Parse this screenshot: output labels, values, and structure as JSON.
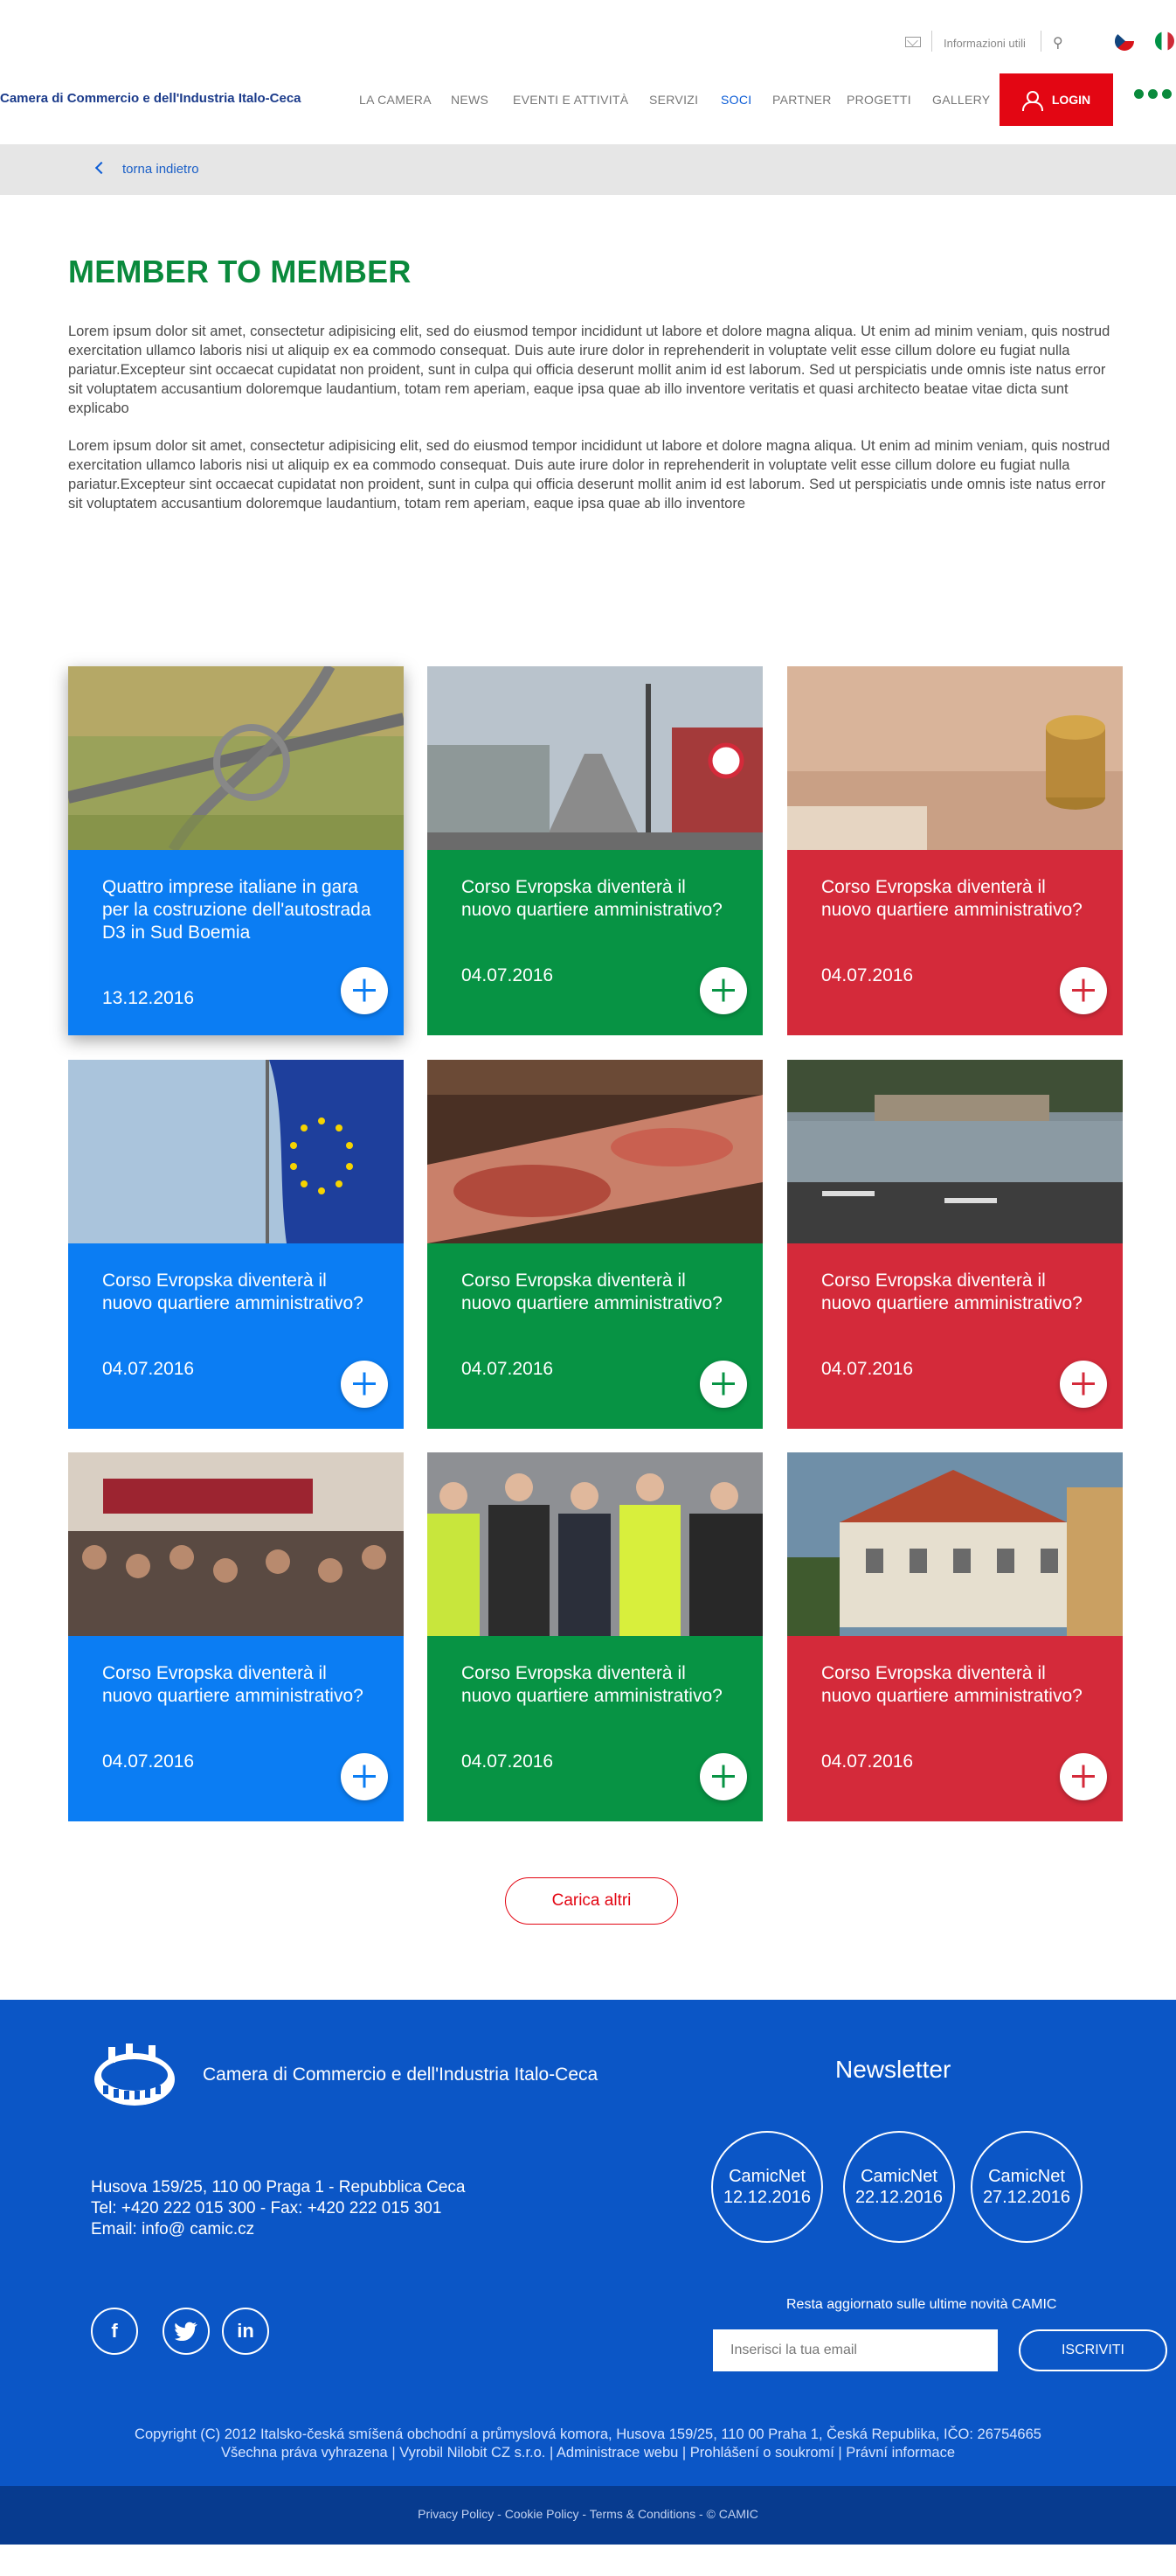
{
  "utility": {
    "info_label": "Informazioni utili"
  },
  "header": {
    "brand": "Camera di Commercio e dell'Industria Italo-Ceca",
    "nav": [
      "LA CAMERA",
      "NEWS",
      "EVENTI E ATTIVITÀ",
      "SERVIZI",
      "SOCI",
      "PARTNER",
      "PROGETTI",
      "GALLERY"
    ],
    "active_nav": "SOCI",
    "login_label": "LOGIN"
  },
  "breadcrumb": {
    "back_label": "torna indietro"
  },
  "intro": {
    "title": "MEMBER TO MEMBER",
    "paragraph_1": "Lorem ipsum dolor sit amet, consectetur adipisicing elit, sed do eiusmod tempor incididunt ut labore et dolore magna aliqua. Ut enim ad minim veniam, quis nostrud exercitation ullamco laboris nisi ut aliquip ex ea commodo consequat. Duis aute irure dolor in reprehenderit in voluptate velit esse cillum dolore eu fugiat nulla pariatur.Excepteur sint occaecat cupidatat non proident, sunt in culpa qui officia deserunt mollit anim id est laborum. Sed ut perspiciatis unde omnis iste natus error sit voluptatem accusantium doloremque laudantium, totam rem aperiam, eaque ipsa quae ab illo inventore veritatis et quasi architecto beatae vitae dicta sunt explicabo",
    "paragraph_2": "Lorem ipsum dolor sit amet, consectetur adipisicing elit, sed do eiusmod tempor incididunt ut labore et dolore magna aliqua. Ut enim ad minim veniam, quis nostrud exercitation ullamco laboris nisi ut aliquip ex ea commodo consequat. Duis aute irure dolor in reprehenderit in voluptate velit esse cillum dolore eu fugiat nulla pariatur.Excepteur sint occaecat cupidatat non proident, sunt in culpa qui officia deserunt mollit anim id est laborum. Sed ut perspiciatis unde omnis iste natus error sit voluptatem accusantium doloremque laudantium, totam rem aperiam, eaque ipsa quae ab illo inventore"
  },
  "cards": [
    {
      "title": "Quattro imprese italiane in gara per la costruzione dell'autostrada D3 in Sud Boemia",
      "date": "13.12.2016",
      "color": "blue",
      "image": "highway-interchange"
    },
    {
      "title": "Corso Evropska diventerà il nuovo quartiere amministrativo?",
      "date": "04.07.2016",
      "color": "green",
      "image": "city-avenue"
    },
    {
      "title": "Corso Evropska diventerà il nuovo quartiere amministrativo?",
      "date": "04.07.2016",
      "color": "red",
      "image": "coins-banknotes"
    },
    {
      "title": "Corso Evropska diventerà il nuovo quartiere amministrativo?",
      "date": "04.07.2016",
      "color": "blue",
      "image": "eu-flag"
    },
    {
      "title": "Corso Evropska diventerà il nuovo quartiere amministrativo?",
      "date": "04.07.2016",
      "color": "green",
      "image": "buffet-food"
    },
    {
      "title": "Corso Evropska diventerà il nuovo quartiere amministrativo?",
      "date": "04.07.2016",
      "color": "red",
      "image": "river-terrace"
    },
    {
      "title": "Corso Evropska diventerà il nuovo quartiere amministrativo?",
      "date": "04.07.2016",
      "color": "blue",
      "image": "conference-audience"
    },
    {
      "title": "Corso Evropska diventerà il nuovo quartiere amministrativo?",
      "date": "04.07.2016",
      "color": "green",
      "image": "site-visit"
    },
    {
      "title": "Corso Evropska diventerà il nuovo quartiere amministrativo?",
      "date": "04.07.2016",
      "color": "red",
      "image": "historic-building"
    }
  ],
  "load_more_label": "Carica altri",
  "footer": {
    "brand": "Camera di Commercio e dell'Industria Italo-Ceca",
    "address": "Husova 159/25, 110 00 Praga 1 - Repubblica Ceca",
    "phone": "Tel: +420 222 015 300 - Fax: +420 222 015 301",
    "email": "Email: info@ camic.cz",
    "newsletter_title": "Newsletter",
    "newsletters": [
      {
        "name": "CamicNet",
        "date": "12.12.2016"
      },
      {
        "name": "CamicNet",
        "date": "22.12.2016"
      },
      {
        "name": "CamicNet",
        "date": "27.12.2016"
      }
    ],
    "subscribe_text": "Resta aggiornato sulle ultime novità CAMIC",
    "email_placeholder": "Inserisci la tua email",
    "subscribe_label": "ISCRIVITI",
    "copyright_line_1": "Copyright (C) 2012 Italsko-česká smíšená obchodní a průmyslová komora, Husova 159/25, 110 00 Praha 1, Česká Republika, IČO: 26754665",
    "copyright_line_2": "Všechna práva vyhrazena | Vyrobil Nilobit CZ s.r.o. | Administrace webu | Prohlášení o soukromí | Právní informace",
    "bottom_links": "Privacy Policy - Cookie Policy - Terms & Conditions - © CAMIC"
  },
  "colors": {
    "blue": "#0b7df3",
    "green": "#079344",
    "red": "#d42a3a",
    "footer": "#0b56c6",
    "login": "#e30613"
  }
}
